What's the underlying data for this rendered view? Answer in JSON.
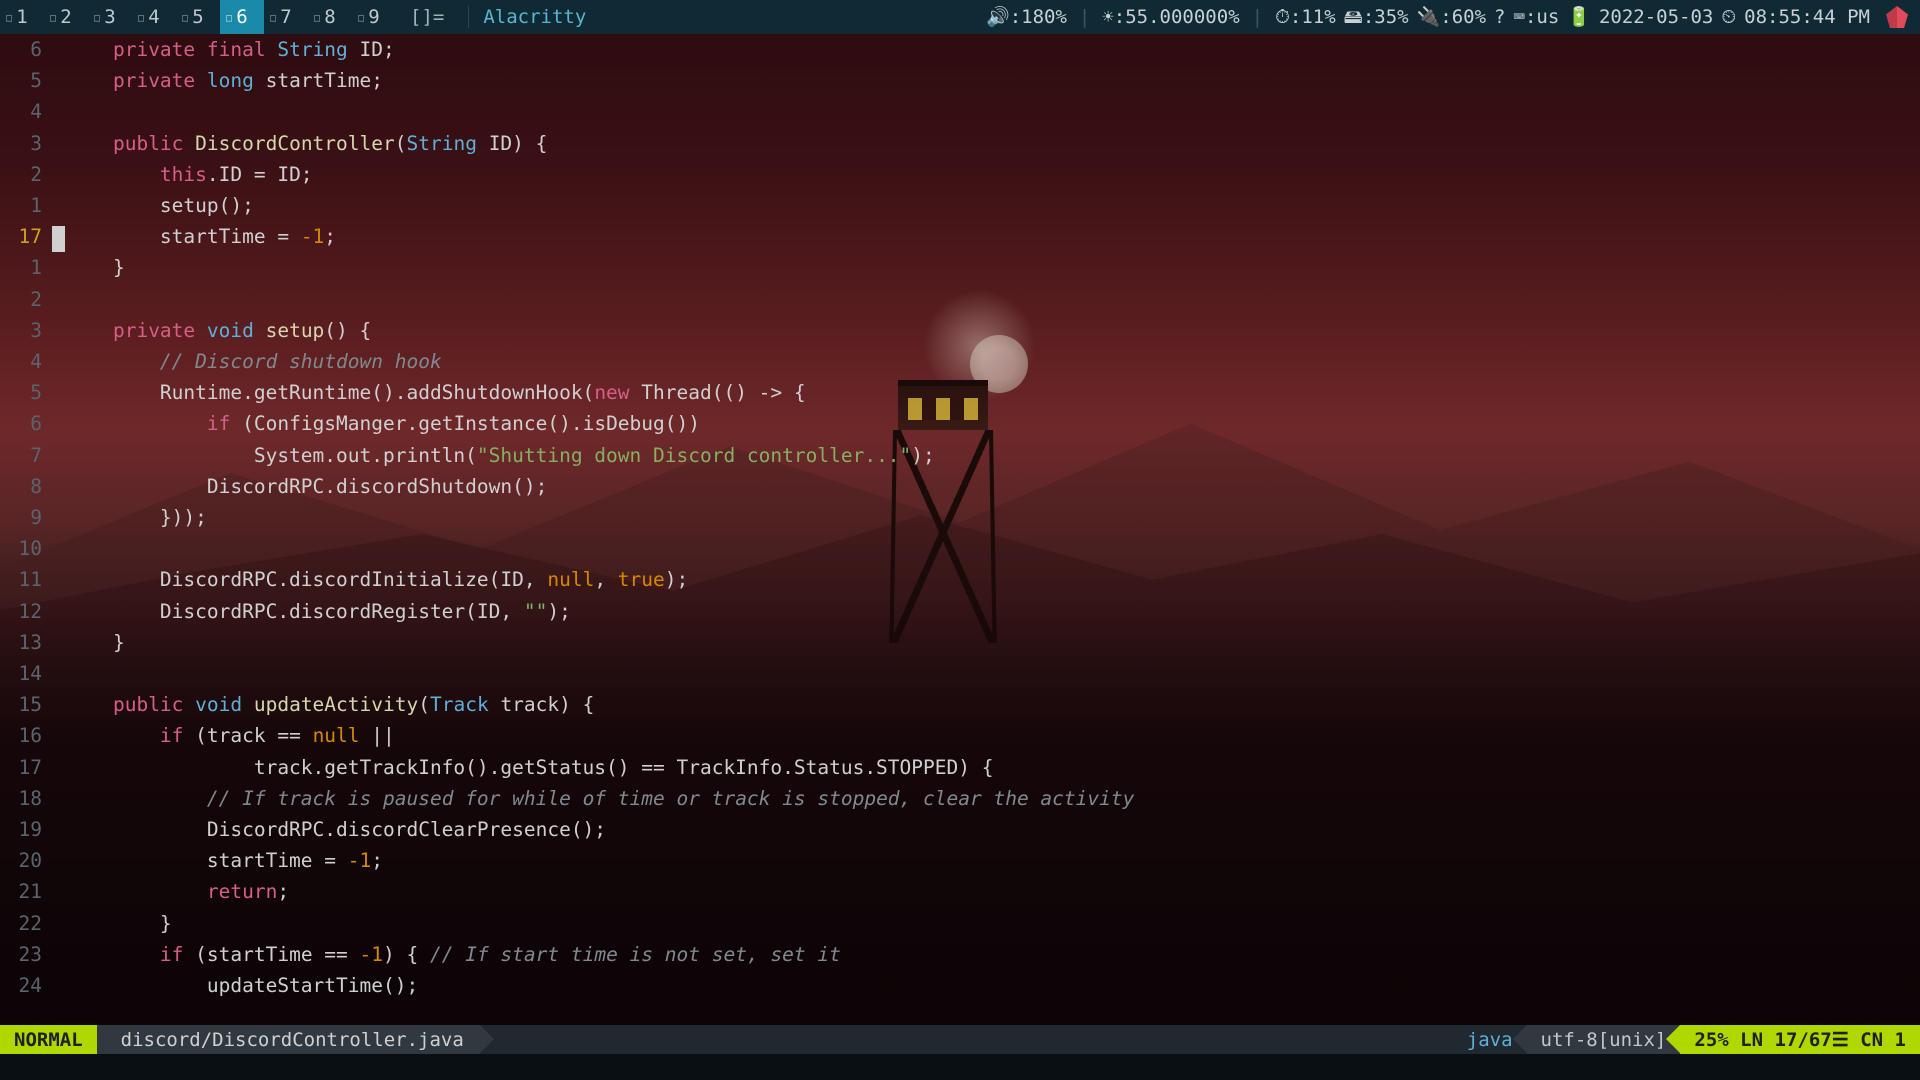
{
  "topbar": {
    "workspaces": [
      {
        "n": "1",
        "active": false
      },
      {
        "n": "2",
        "active": false
      },
      {
        "n": "3",
        "active": false
      },
      {
        "n": "4",
        "active": false
      },
      {
        "n": "5",
        "active": false
      },
      {
        "n": "6",
        "active": true
      },
      {
        "n": "7",
        "active": false
      },
      {
        "n": "8",
        "active": false
      },
      {
        "n": "9",
        "active": false
      }
    ],
    "layout": "[]=",
    "title": "Alacritty",
    "status": {
      "vol": "🔊:180%",
      "bright": "☀:55.000000%",
      "cpu": "⏱:11%",
      "mem": "🖴:35%",
      "bat": "🔌:60%",
      "unk": "?",
      "kb": "⌨:us",
      "charge": "🔋",
      "date": "2022-05-03",
      "clock": "⏲",
      "time": "08:55:44 PM"
    }
  },
  "editor": {
    "current_abs": 17,
    "lines": [
      {
        "rel": "6",
        "tokens": [
          [
            "    ",
            ""
          ],
          [
            "private ",
            "kw"
          ],
          [
            "final ",
            "kw"
          ],
          [
            "String ",
            "type"
          ],
          [
            "ID;",
            ""
          ]
        ]
      },
      {
        "rel": "5",
        "tokens": [
          [
            "    ",
            ""
          ],
          [
            "private ",
            "kw"
          ],
          [
            "long ",
            "type"
          ],
          [
            "startTime;",
            ""
          ]
        ]
      },
      {
        "rel": "4",
        "tokens": [
          [
            "",
            ""
          ]
        ]
      },
      {
        "rel": "3",
        "tokens": [
          [
            "    ",
            ""
          ],
          [
            "public ",
            "kw"
          ],
          [
            "DiscordController",
            "func"
          ],
          [
            "(",
            ""
          ],
          [
            "String ",
            "type"
          ],
          [
            "ID) {",
            ""
          ]
        ]
      },
      {
        "rel": "2",
        "tokens": [
          [
            "        ",
            ""
          ],
          [
            "this",
            "kw"
          ],
          [
            ".ID = ID;",
            ""
          ]
        ]
      },
      {
        "rel": "1",
        "tokens": [
          [
            "        setup();",
            ""
          ]
        ]
      },
      {
        "rel": "17",
        "cursor": true,
        "tokens": [
          [
            "        startTime = ",
            ""
          ],
          [
            "-1",
            "num"
          ],
          [
            ";",
            ""
          ]
        ]
      },
      {
        "rel": "1",
        "tokens": [
          [
            "    }",
            ""
          ]
        ]
      },
      {
        "rel": "2",
        "tokens": [
          [
            "",
            ""
          ]
        ]
      },
      {
        "rel": "3",
        "tokens": [
          [
            "    ",
            ""
          ],
          [
            "private ",
            "kw"
          ],
          [
            "void ",
            "type"
          ],
          [
            "setup",
            "func"
          ],
          [
            "() {",
            ""
          ]
        ]
      },
      {
        "rel": "4",
        "tokens": [
          [
            "        ",
            ""
          ],
          [
            "// Discord shutdown hook",
            "comment"
          ]
        ]
      },
      {
        "rel": "5",
        "tokens": [
          [
            "        Runtime.getRuntime().addShutdownHook(",
            ""
          ],
          [
            "new ",
            "kw"
          ],
          [
            "Thread(() -> {",
            ""
          ]
        ]
      },
      {
        "rel": "6",
        "tokens": [
          [
            "            ",
            ""
          ],
          [
            "if ",
            "kw"
          ],
          [
            "(ConfigsManger.getInstance().isDebug())",
            ""
          ]
        ]
      },
      {
        "rel": "7",
        "tokens": [
          [
            "                System.out.println(",
            ""
          ],
          [
            "\"Shutting down Discord controller...\"",
            "str"
          ],
          [
            ");",
            ""
          ]
        ]
      },
      {
        "rel": "8",
        "tokens": [
          [
            "            DiscordRPC.discordShutdown();",
            ""
          ]
        ]
      },
      {
        "rel": "9",
        "tokens": [
          [
            "        }));",
            ""
          ]
        ]
      },
      {
        "rel": "10",
        "tokens": [
          [
            "",
            ""
          ]
        ]
      },
      {
        "rel": "11",
        "tokens": [
          [
            "        DiscordRPC.discordInitialize(ID, ",
            ""
          ],
          [
            "null",
            "bool"
          ],
          [
            ", ",
            ""
          ],
          [
            "true",
            "bool"
          ],
          [
            ");",
            ""
          ]
        ]
      },
      {
        "rel": "12",
        "tokens": [
          [
            "        DiscordRPC.discordRegister(ID, ",
            ""
          ],
          [
            "\"\"",
            "str"
          ],
          [
            ");",
            ""
          ]
        ]
      },
      {
        "rel": "13",
        "tokens": [
          [
            "    }",
            ""
          ]
        ]
      },
      {
        "rel": "14",
        "tokens": [
          [
            "",
            ""
          ]
        ]
      },
      {
        "rel": "15",
        "tokens": [
          [
            "    ",
            ""
          ],
          [
            "public ",
            "kw"
          ],
          [
            "void ",
            "type"
          ],
          [
            "updateActivity",
            "func"
          ],
          [
            "(",
            ""
          ],
          [
            "Track ",
            "type"
          ],
          [
            "track) {",
            ""
          ]
        ]
      },
      {
        "rel": "16",
        "tokens": [
          [
            "        ",
            ""
          ],
          [
            "if ",
            "kw"
          ],
          [
            "(track == ",
            ""
          ],
          [
            "null ",
            "bool"
          ],
          [
            "||",
            ""
          ]
        ]
      },
      {
        "rel": "17",
        "tokens": [
          [
            "                track.getTrackInfo().getStatus() == TrackInfo.Status.STOPPED) {",
            ""
          ]
        ]
      },
      {
        "rel": "18",
        "tokens": [
          [
            "            ",
            ""
          ],
          [
            "// If track is paused for while of time or track is stopped, clear the activity",
            "comment"
          ]
        ]
      },
      {
        "rel": "19",
        "tokens": [
          [
            "            DiscordRPC.discordClearPresence();",
            ""
          ]
        ]
      },
      {
        "rel": "20",
        "tokens": [
          [
            "            startTime = ",
            ""
          ],
          [
            "-1",
            "num"
          ],
          [
            ";",
            ""
          ]
        ]
      },
      {
        "rel": "21",
        "tokens": [
          [
            "            ",
            ""
          ],
          [
            "return",
            "kw"
          ],
          [
            ";",
            ""
          ]
        ]
      },
      {
        "rel": "22",
        "tokens": [
          [
            "        }",
            ""
          ]
        ]
      },
      {
        "rel": "23",
        "tokens": [
          [
            "        ",
            ""
          ],
          [
            "if ",
            "kw"
          ],
          [
            "(startTime == ",
            ""
          ],
          [
            "-1",
            "num"
          ],
          [
            ") { ",
            ""
          ],
          [
            "// If start time is not set, set it",
            "comment"
          ]
        ]
      },
      {
        "rel": "24",
        "tokens": [
          [
            "            updateStartTime();",
            ""
          ]
        ]
      }
    ]
  },
  "status": {
    "mode": "NORMAL",
    "file": "discord/DiscordController.java",
    "filetype": "java",
    "encoding": "utf-8[unix]",
    "percent": "25%",
    "ln_label": "LN",
    "line": "17/67",
    "sep_icon": "☰",
    "cn_label": "CN",
    "col": "1"
  }
}
